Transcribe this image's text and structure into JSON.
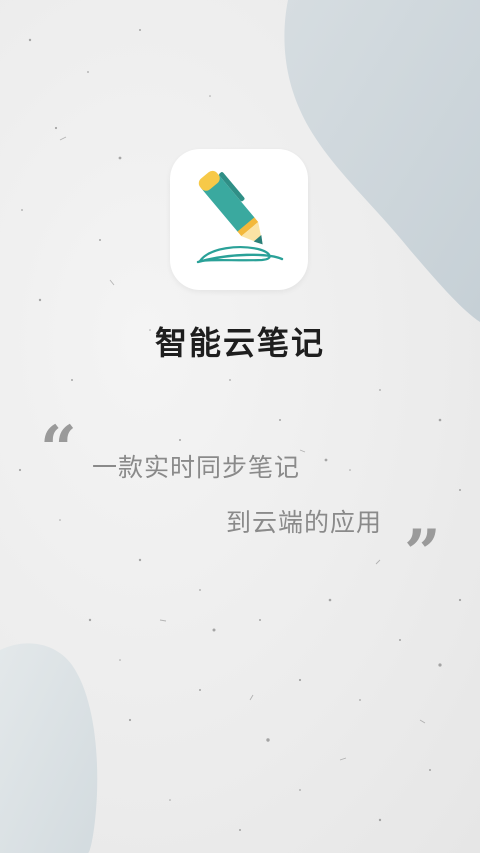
{
  "app": {
    "name": "智能云笔记",
    "icon": "pen-writing-icon"
  },
  "slogan": {
    "line1": "一款实时同步笔记",
    "line2": "到云端的应用",
    "quote_open": "“",
    "quote_close": "”"
  },
  "colors": {
    "background": "#efefef",
    "blob": "#cfd8dd",
    "pen_body": "#3aa99f",
    "pen_cap": "#f7c948",
    "ink_line": "#2aa198",
    "title": "#1e1e1e",
    "slogan": "#8a8a8a"
  }
}
